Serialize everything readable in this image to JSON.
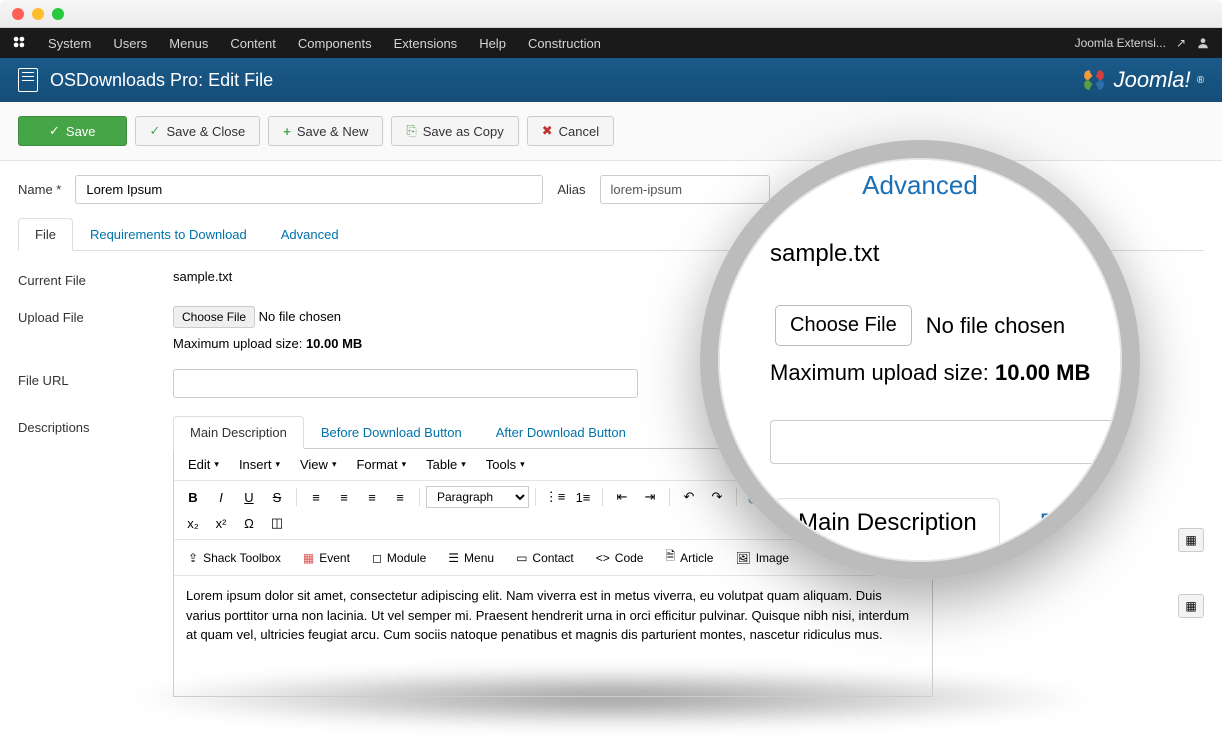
{
  "topMenu": {
    "items": [
      "System",
      "Users",
      "Menus",
      "Content",
      "Components",
      "Extensions",
      "Help",
      "Construction"
    ],
    "siteName": "Joomla Extensi...",
    "externalIcon": "↗"
  },
  "titleBar": {
    "title": "OSDownloads Pro: Edit File",
    "logoText": "Joomla!"
  },
  "toolbar": {
    "save": "Save",
    "saveClose": "Save & Close",
    "saveNew": "Save & New",
    "saveCopy": "Save as Copy",
    "cancel": "Cancel"
  },
  "form": {
    "nameLabel": "Name *",
    "nameValue": "Lorem Ipsum",
    "aliasLabel": "Alias",
    "aliasValue": "lorem-ipsum"
  },
  "tabs": {
    "file": "File",
    "requirements": "Requirements to Download",
    "advanced": "Advanced"
  },
  "fields": {
    "currentFileLabel": "Current File",
    "currentFileValue": "sample.txt",
    "uploadLabel": "Upload File",
    "chooseFile": "Choose File",
    "noFile": "No file chosen",
    "maxUploadPrefix": "Maximum upload size: ",
    "maxUploadValue": "10.00 MB",
    "fileUrlLabel": "File URL",
    "descriptionsLabel": "Descriptions"
  },
  "subtabs": {
    "main": "Main Description",
    "before": "Before Download Button",
    "after": "After Download Button"
  },
  "editor": {
    "menus": [
      "Edit",
      "Insert",
      "View",
      "Format",
      "Table",
      "Tools"
    ],
    "paragraph": "Paragraph",
    "chips": {
      "shack": "Shack Toolbox",
      "event": "Event",
      "module": "Module",
      "menu": "Menu",
      "contact": "Contact",
      "code": "Code",
      "article": "Article",
      "image": "Image"
    },
    "content": "Lorem ipsum dolor sit amet, consectetur adipiscing elit. Nam viverra est in metus viverra, eu volutpat quam aliquam. Duis varius porttitor urna non lacinia. Ut vel semper mi. Praesent hendrerit urna in orci efficitur pulvinar. Quisque nibh nisi, interdum at quam vel, ultricies feugiat arcu. Cum sociis natoque penatibus et magnis dis parturient montes, nascetur ridiculus mus."
  },
  "magnifier": {
    "advanced": "Advanced",
    "sample": "sample.txt",
    "chooseFile": "Choose File",
    "noFile": "No file chosen",
    "maxPrefix": "Maximum upload size: ",
    "maxValue": "10.00 MB",
    "mainDesc": "Main Description",
    "before": "Before"
  }
}
